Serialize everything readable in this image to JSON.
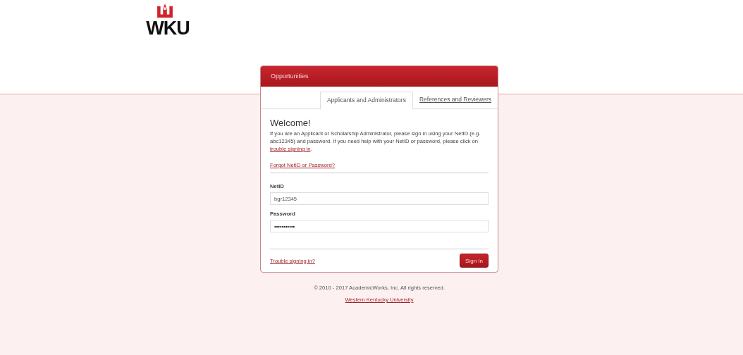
{
  "logo": {
    "text": "WKU"
  },
  "card": {
    "header": "Opportunities",
    "tabs": [
      {
        "label": "Applicants and Administrators",
        "selected": true
      },
      {
        "label": "References and Reviewers",
        "selected": false
      }
    ],
    "heading": "Welcome!",
    "intro": {
      "before": "If you are an Applicant or Scholarship Administrator, please sign in using your NetID (e.g. abc12345) and password. If you need help with your NetID or password, please click on ",
      "link": "trouble signing in",
      "after": "."
    },
    "forgot_link": "Forgot NetID or Password?",
    "fields": [
      {
        "label": "NetID",
        "value": "bgr12345",
        "kind": "text"
      },
      {
        "label": "Password",
        "value": "•••••••••••",
        "kind": "password"
      }
    ],
    "trouble_link": "Trouble signing in?",
    "sign_in_button": "Sign In"
  },
  "footer": {
    "copyright": "© 2010 - 2017 AcademicWorks, Inc. All rights reserved.",
    "link": "Western Kentucky University"
  }
}
